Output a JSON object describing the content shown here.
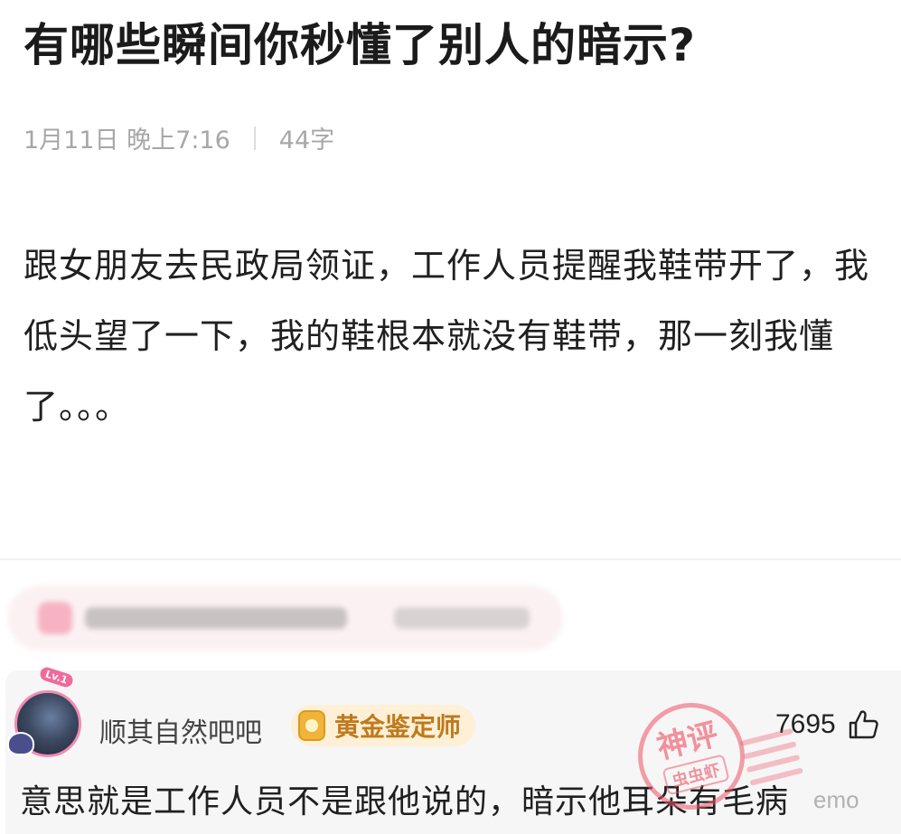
{
  "post": {
    "title": "有哪些瞬间你秒懂了别人的暗示?",
    "date": "1月11日",
    "time": "晚上7:16",
    "word_count": "44字",
    "body": "跟女朋友去民政局领证，工作人员提醒我鞋带开了，我低头望了一下，我的鞋根本就没有鞋带，那一刻我懂了。。。"
  },
  "comment": {
    "avatar_level": "Lv.1",
    "username": "顺其自然吧吧",
    "badge_label": "黄金鉴定师",
    "like_count": "7695",
    "text": "意思就是工作人员不是跟他说的，暗示他耳朵有毛病"
  },
  "stamp": {
    "main_text": "神评",
    "sub_text": "虫虫虾"
  },
  "watermark": {
    "text": "emo"
  },
  "colors": {
    "badge_gold": "#f0b43a",
    "badge_text": "#c07a1c",
    "stamp_red": "#ec5264",
    "avatar_ring": "#f28bb0"
  },
  "icons": {
    "like": "thumbs-up-icon",
    "badge": "gold-appraiser-icon"
  }
}
